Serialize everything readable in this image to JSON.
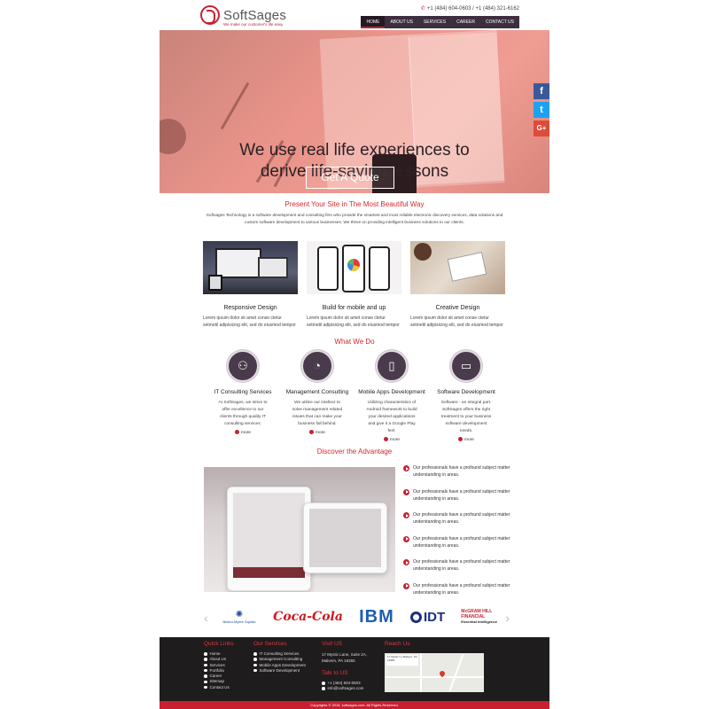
{
  "brand": {
    "name": "SoftSages",
    "tagline": "We make our customer's life easy"
  },
  "header": {
    "phone": "+1 (484) 604-0603 / +1 (484) 321-6162",
    "nav": [
      "HOME",
      "ABOUT US",
      "SERVICES",
      "CAREER",
      "CONTACT US"
    ]
  },
  "hero": {
    "line1": "We use real life experiences to",
    "line2": "derive life-saving lessons",
    "cta": "Get A Quote"
  },
  "social": [
    "f",
    "t",
    "G+"
  ],
  "intro": {
    "title": "Present Your Site in The Most Beautiful Way",
    "body": "Softsages Technology is a software development and consulting firm who provide the smartest and most reliable electronic discovery services, data solutions and custom software development to various businesses. We thrive on providing intelligent business solutions to our clients."
  },
  "features": [
    {
      "title": "Responsive Design",
      "text": "Lorem ipsum dolor sit amet conse ctetur setmetil adipisicing elit, sed do eiusmod tempor"
    },
    {
      "title": "Build for mobile and up",
      "text": "Lorem ipsum dolor sit amet conse ctetur setmetil adipisicing elit, sed do eiusmod tempor"
    },
    {
      "title": "Creative Design",
      "text": "Lorem ipsum dolor sit amet conse ctetur setmetil adipisicing elit, sed do eiusmod tempor"
    }
  ],
  "what_we_do": {
    "title": "What We Do",
    "more_label": "more",
    "services": [
      {
        "title": "IT Consulting Services",
        "text": "At SoftSages, we strive to offer excellence to our clients through quality IT consulting services."
      },
      {
        "title": "Management Consulting",
        "text": "We utilize our intellect to solve management related issues that can make your business fall behind."
      },
      {
        "title": "Mobile Apps Development",
        "text": "Utilizing characteristics of Android framework to build your desired applications and give it a Google Play feel."
      },
      {
        "title": "Software Development",
        "text": "Software - an integral part. SoftSages offers the right treatment to your business software development needs."
      }
    ]
  },
  "advantage": {
    "title": "Discover the Advantage",
    "items": [
      "Our professionals have a profound subject matter understanding in areas.",
      "Our professionals have a profound subject matter understanding in areas.",
      "Our professionals have a profound subject matter understanding in areas.",
      "Our professionals have a profound subject matter understanding in areas.",
      "Our professionals have a profound subject matter understanding in areas.",
      "Our professionals have a profound subject matter understanding in areas."
    ]
  },
  "clients": {
    "prev": "‹",
    "next": "›",
    "bms": "Bristol-Myers Squibb",
    "coke": "Coca-Cola",
    "ibm": "IBM",
    "idt": "IDT",
    "mh1": "McGRAW HILL",
    "mh2": "FINANCIAL",
    "mh3": "Essential Intelligence"
  },
  "footer": {
    "quick_links_title": "Quick Links",
    "quick_links": [
      "Home",
      "About Us",
      "Services",
      "Portfolio",
      "Career",
      "Sitemap",
      "Contact Us"
    ],
    "services_title": "Our Services",
    "services": [
      "IT Consulting Services",
      "Management Consulting",
      "Mobile Apps Development",
      "Software Development"
    ],
    "visit_title": "Visit US",
    "address": [
      "17 Mystic Lane, Suite 2A,",
      "Malvern, PA 19355"
    ],
    "talk_title": "Talk to US",
    "phone": "+1 (484) 604-0603",
    "email": "info@softsages.com",
    "reach_title": "Reach Us",
    "map_label": "17 Mystic Ln Malvern, PA 19355",
    "copyright": "Copyrights © 2016. softsages.com. All Rights Reserved."
  },
  "colors": {
    "accent": "#c8202f",
    "nav_bg": "#3d2f3e",
    "footer_bg": "#1f1c1e",
    "facebook": "#3b5998",
    "twitter": "#1da1f2",
    "googleplus": "#dd4b39"
  },
  "icons": {
    "phone": "phone-icon",
    "social": [
      "facebook-icon",
      "twitter-icon",
      "googleplus-icon"
    ],
    "services": [
      "team-icon",
      "pie-chart-icon",
      "mobile-icon",
      "code-window-icon"
    ]
  }
}
